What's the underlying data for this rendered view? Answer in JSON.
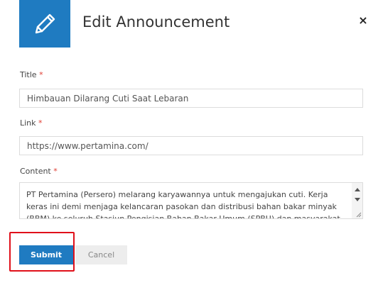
{
  "dialog": {
    "title": "Edit Announcement",
    "close_label": "×"
  },
  "form": {
    "title_field": {
      "label": "Title",
      "required_mark": "*",
      "value": "Himbauan Dilarang Cuti Saat Lebaran"
    },
    "link_field": {
      "label": "Link",
      "required_mark": "*",
      "value": "https://www.pertamina.com/"
    },
    "content_field": {
      "label": "Content",
      "required_mark": "*",
      "value": "PT Pertamina (Persero) melarang karyawannya untuk mengajukan cuti. Kerja keras ini demi menjaga kelancaran pasokan dan distribusi bahan bakar minyak (BBM) ke seluruh Stasiun Pengisian Bahan Bakar Umum (SPBU) dan masyarakat."
    }
  },
  "actions": {
    "submit_label": "Submit",
    "cancel_label": "Cancel"
  },
  "icons": {
    "header": "pencil-icon",
    "close": "close-icon"
  },
  "colors": {
    "accent": "#1f7bc1",
    "required": "#e03c31",
    "highlight": "#e0101a"
  }
}
